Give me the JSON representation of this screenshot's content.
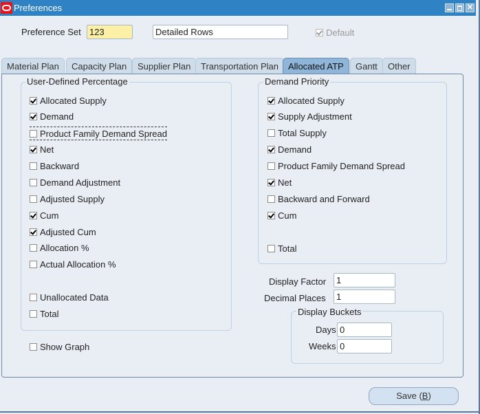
{
  "window": {
    "title": "Preferences",
    "controls": [
      "minimize-icon",
      "maximize-icon",
      "close-icon"
    ]
  },
  "header": {
    "preference_set_label": "Preference Set",
    "preference_set_value": "123",
    "description_value": "Detailed Rows",
    "default_label": "Default",
    "default_checked": true
  },
  "tabs": [
    {
      "label": "Material Plan",
      "active": false
    },
    {
      "label": "Capacity Plan",
      "active": false
    },
    {
      "label": "Supplier Plan",
      "active": false
    },
    {
      "label": "Transportation Plan",
      "active": false
    },
    {
      "label": "Allocated ATP",
      "active": true
    },
    {
      "label": "Gantt",
      "active": false
    },
    {
      "label": "Other",
      "active": false
    }
  ],
  "user_defined_percentage": {
    "title": "User-Defined Percentage",
    "items": [
      {
        "label": "Allocated Supply",
        "checked": true
      },
      {
        "label": "Demand",
        "checked": true
      },
      {
        "label": "Product Family Demand Spread",
        "checked": false
      },
      {
        "label": "Net",
        "checked": true
      },
      {
        "label": "Backward",
        "checked": false
      },
      {
        "label": "Demand Adjustment",
        "checked": false
      },
      {
        "label": "Adjusted Supply",
        "checked": false
      },
      {
        "label": "Cum",
        "checked": true
      },
      {
        "label": "Adjusted Cum",
        "checked": true
      },
      {
        "label": "Allocation %",
        "checked": false
      },
      {
        "label": "Actual Allocation %",
        "checked": false
      },
      {
        "label": "Unallocated Data",
        "checked": false
      },
      {
        "label": "Total",
        "checked": false
      }
    ]
  },
  "show_graph": {
    "label": "Show Graph",
    "checked": false
  },
  "demand_priority": {
    "title": "Demand Priority",
    "items": [
      {
        "label": "Allocated Supply",
        "checked": true
      },
      {
        "label": "Supply Adjustment",
        "checked": true
      },
      {
        "label": "Total Supply",
        "checked": false
      },
      {
        "label": "Demand",
        "checked": true
      },
      {
        "label": "Product Family Demand Spread",
        "checked": false
      },
      {
        "label": "Net",
        "checked": true
      },
      {
        "label": "Backward and Forward",
        "checked": false
      },
      {
        "label": "Cum",
        "checked": true
      },
      {
        "label": "Total",
        "checked": false
      }
    ]
  },
  "display": {
    "factor_label": "Display Factor",
    "factor_value": "1",
    "decimal_label": "Decimal Places",
    "decimal_value": "1"
  },
  "display_buckets": {
    "title": "Display Buckets",
    "days_label": "Days",
    "days_value": "0",
    "weeks_label": "Weeks",
    "weeks_value": "0"
  },
  "save_button": {
    "label": "Save (",
    "mnemonic": "B",
    "suffix": ")"
  }
}
